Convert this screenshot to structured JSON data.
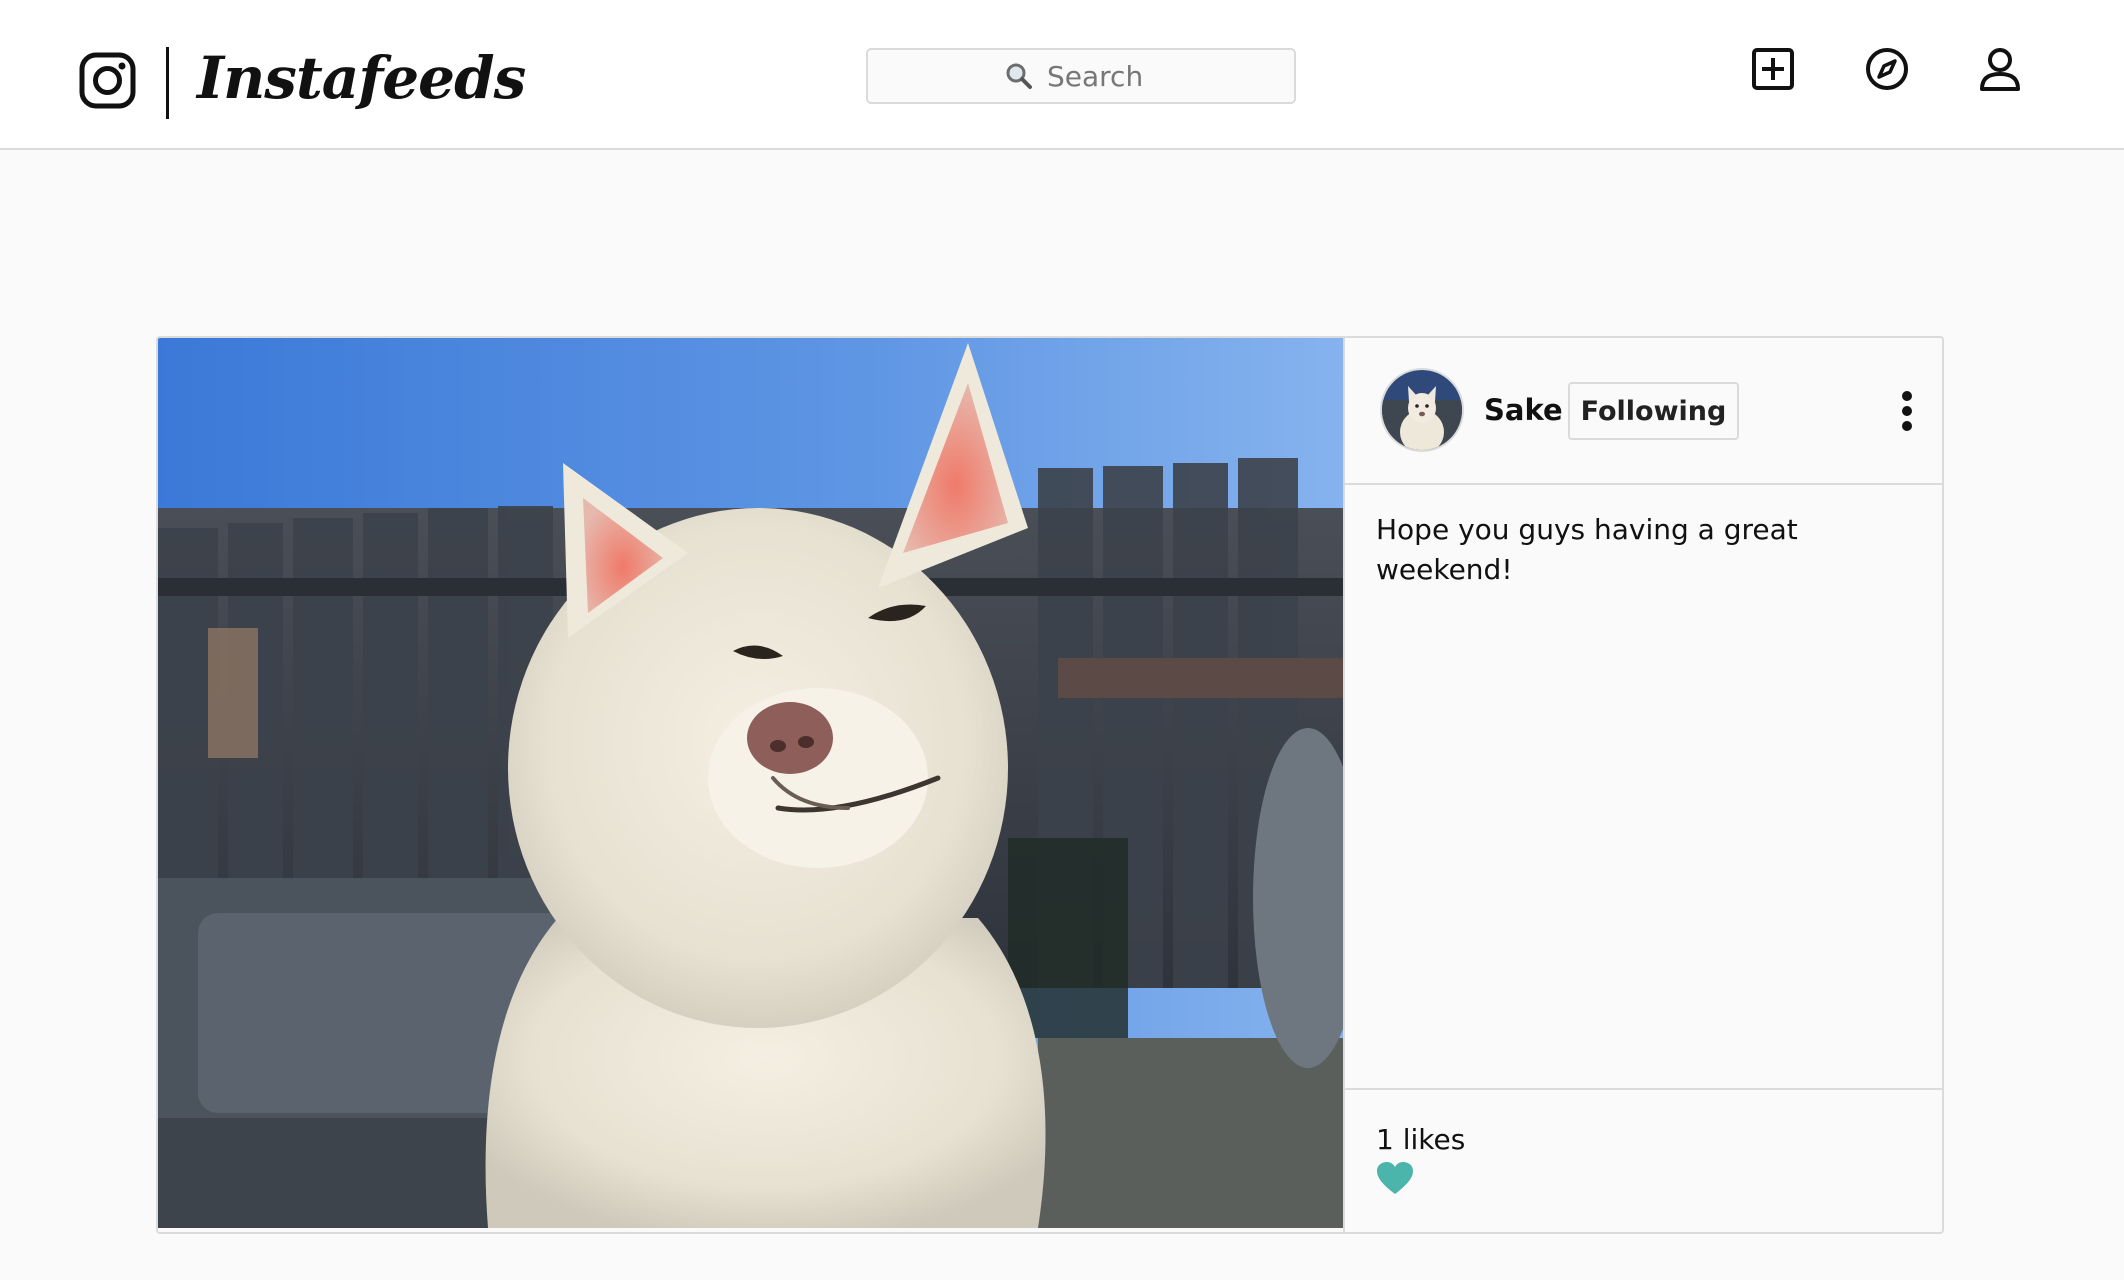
{
  "app": {
    "brand_name": "Instafeeds",
    "logo_icon": "instagram-camera-icon"
  },
  "search": {
    "placeholder": "Search",
    "icon": "magnifier-icon"
  },
  "nav": {
    "items": [
      {
        "icon": "add-post-icon"
      },
      {
        "icon": "explore-compass-icon"
      },
      {
        "icon": "profile-user-icon"
      }
    ]
  },
  "post": {
    "author": {
      "username": "Sake",
      "avatar": "white-dog-avatar"
    },
    "follow_label": "Following",
    "more_icon": "vertical-ellipsis-icon",
    "photo": "white-akita-dog-photo",
    "caption": "Hope you guys having a great weekend!",
    "likes_text": "1 likes",
    "like_icon": "heart-icon",
    "like_color": "#4cb5ab"
  }
}
